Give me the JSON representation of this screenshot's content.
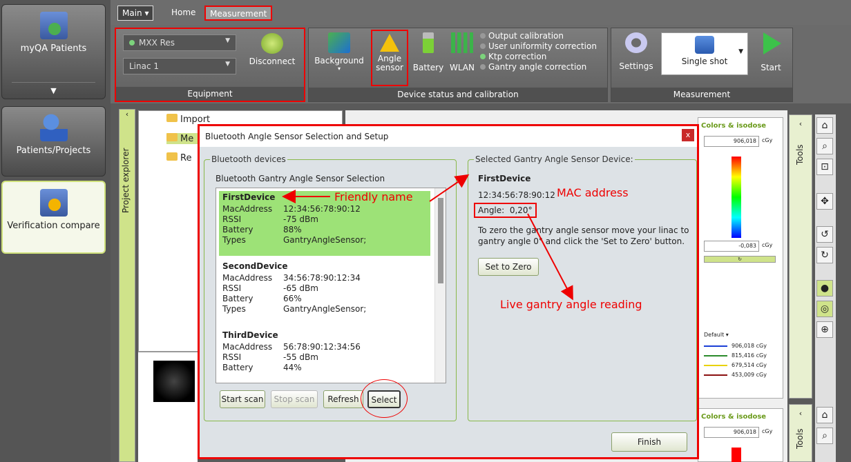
{
  "nav": {
    "myqa_label": "myQA Patients",
    "patients_label": "Patients/Projects",
    "verification_label": "Verification compare"
  },
  "tabs": {
    "main": "Main ▾",
    "home": "Home",
    "measurement": "Measurement"
  },
  "equipment": {
    "device_combo": "MXX Res",
    "linac_combo": "Linac 1",
    "disconnect": "Disconnect",
    "footer": "Equipment"
  },
  "device_status": {
    "background": "Background",
    "angle_sensor": "Angle sensor",
    "battery": "Battery",
    "wlan": "WLAN",
    "options": [
      "Output calibration",
      "User uniformity correction",
      "Ktp correction",
      "Gantry angle correction"
    ],
    "footer": "Device status and calibration"
  },
  "measurement": {
    "settings": "Settings",
    "single_shot": "Single shot",
    "start": "Start",
    "footer": "Measurement"
  },
  "explorer": {
    "tab_label": "Project explorer",
    "items": [
      "Import",
      "Me",
      "Re"
    ]
  },
  "isodose": {
    "title": "Colors & isodose",
    "max_value": "906,018",
    "min_value": "-0,083",
    "unit": "cGy",
    "preset": "Default",
    "legend": [
      "906,018 cGy",
      "815,416 cGy",
      "679,514 cGy",
      "453,009 cGy"
    ],
    "tools_label": "Tools"
  },
  "dialog": {
    "title": "Bluetooth Angle Sensor Selection and Setup",
    "close": "x",
    "left_legend": "Bluetooth devices",
    "left_subtitle": "Bluetooth Gantry Angle Sensor Selection",
    "devices": [
      {
        "name": "FirstDevice",
        "mac": "12:34:56:78:90:12",
        "rssi": "-75 dBm",
        "battery": "88%",
        "types": "GantryAngleSensor;"
      },
      {
        "name": "SecondDevice",
        "mac": "34:56:78:90:12:34",
        "rssi": "-65 dBm",
        "battery": "66%",
        "types": "GantryAngleSensor;"
      },
      {
        "name": "ThirdDevice",
        "mac": "56:78:90:12:34:56",
        "rssi": "-55 dBm",
        "battery": "44%"
      }
    ],
    "labels": {
      "mac": "MacAddress",
      "rssi": "RSSI",
      "battery": "Battery",
      "types": "Types"
    },
    "buttons": {
      "start_scan": "Start scan",
      "stop_scan": "Stop scan",
      "refresh": "Refresh",
      "select": "Select",
      "set_zero": "Set to Zero",
      "finish": "Finish"
    },
    "right_legend": "Selected Gantry Angle Sensor Device:",
    "selected_name": "FirstDevice",
    "selected_mac": "12:34:56:78:90:12",
    "angle_label": "Angle:",
    "angle_value": "0,20°",
    "instructions": "To zero the gantry angle sensor move your linac to gantry angle 0° and click the 'Set to Zero' button."
  },
  "annotations": {
    "friendly_name": "Friendly name",
    "mac_address": "MAC address",
    "live_angle": "Live gantry angle reading"
  },
  "colors": {
    "accent_green": "#9de277",
    "annotation_red": "#e00000"
  }
}
